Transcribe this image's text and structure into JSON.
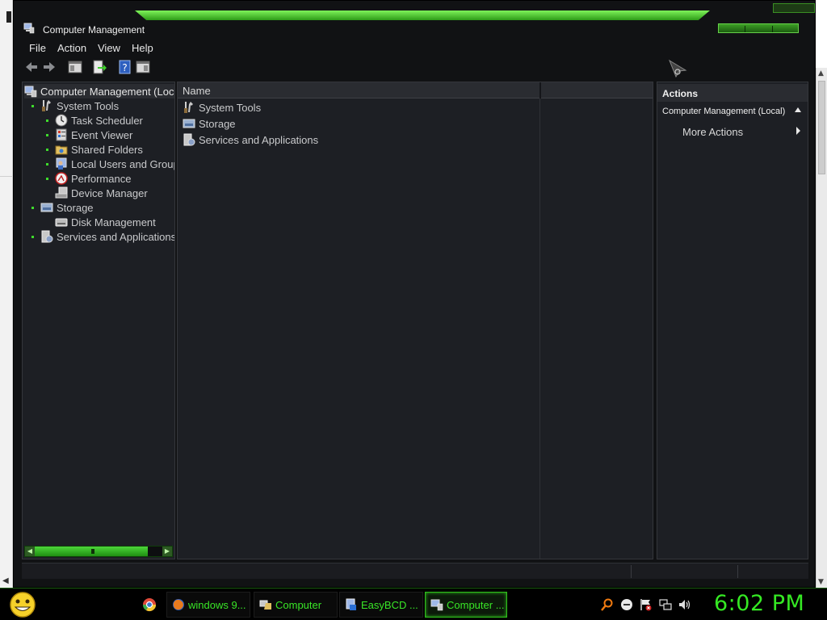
{
  "window": {
    "title": "Computer Management"
  },
  "menu": [
    "File",
    "Action",
    "View",
    "Help"
  ],
  "toolbar": {
    "buttons": [
      "back-icon",
      "forward-icon",
      "show-hide-console-tree-icon",
      "export-list-icon",
      "help-icon",
      "show-hide-action-pane-icon"
    ]
  },
  "tree": {
    "root": "Computer Management (Local)",
    "items": [
      {
        "label": "System Tools",
        "icon": "tools-icon"
      },
      {
        "label": "Task Scheduler",
        "icon": "clock-icon"
      },
      {
        "label": "Event Viewer",
        "icon": "event-viewer-icon"
      },
      {
        "label": "Shared Folders",
        "icon": "shared-folder-icon"
      },
      {
        "label": "Local Users and Groups",
        "icon": "users-icon"
      },
      {
        "label": "Performance",
        "icon": "performance-icon"
      },
      {
        "label": "Device Manager",
        "icon": "device-manager-icon"
      },
      {
        "label": "Storage",
        "icon": "storage-icon"
      },
      {
        "label": "Disk Management",
        "icon": "disk-icon"
      },
      {
        "label": "Services and Applications",
        "icon": "services-icon"
      }
    ]
  },
  "list": {
    "column_name": "Name",
    "rows": [
      "System Tools",
      "Storage",
      "Services and Applications"
    ]
  },
  "actions": {
    "header": "Actions",
    "context": "Computer Management (Local)",
    "more": "More Actions"
  },
  "taskbar": {
    "buttons": [
      {
        "label": "windows 9...",
        "icon": "firefox-icon"
      },
      {
        "label": "Computer",
        "icon": "computer-folder-icon"
      },
      {
        "label": "EasyBCD ...",
        "icon": "easybcd-icon"
      },
      {
        "label": "Computer ...",
        "icon": "computer-management-icon"
      }
    ],
    "clock": "6:02 PM"
  },
  "colors": {
    "accent": "#39e627",
    "window_bg": "#111214",
    "pane_bg": "#1d1f24"
  }
}
